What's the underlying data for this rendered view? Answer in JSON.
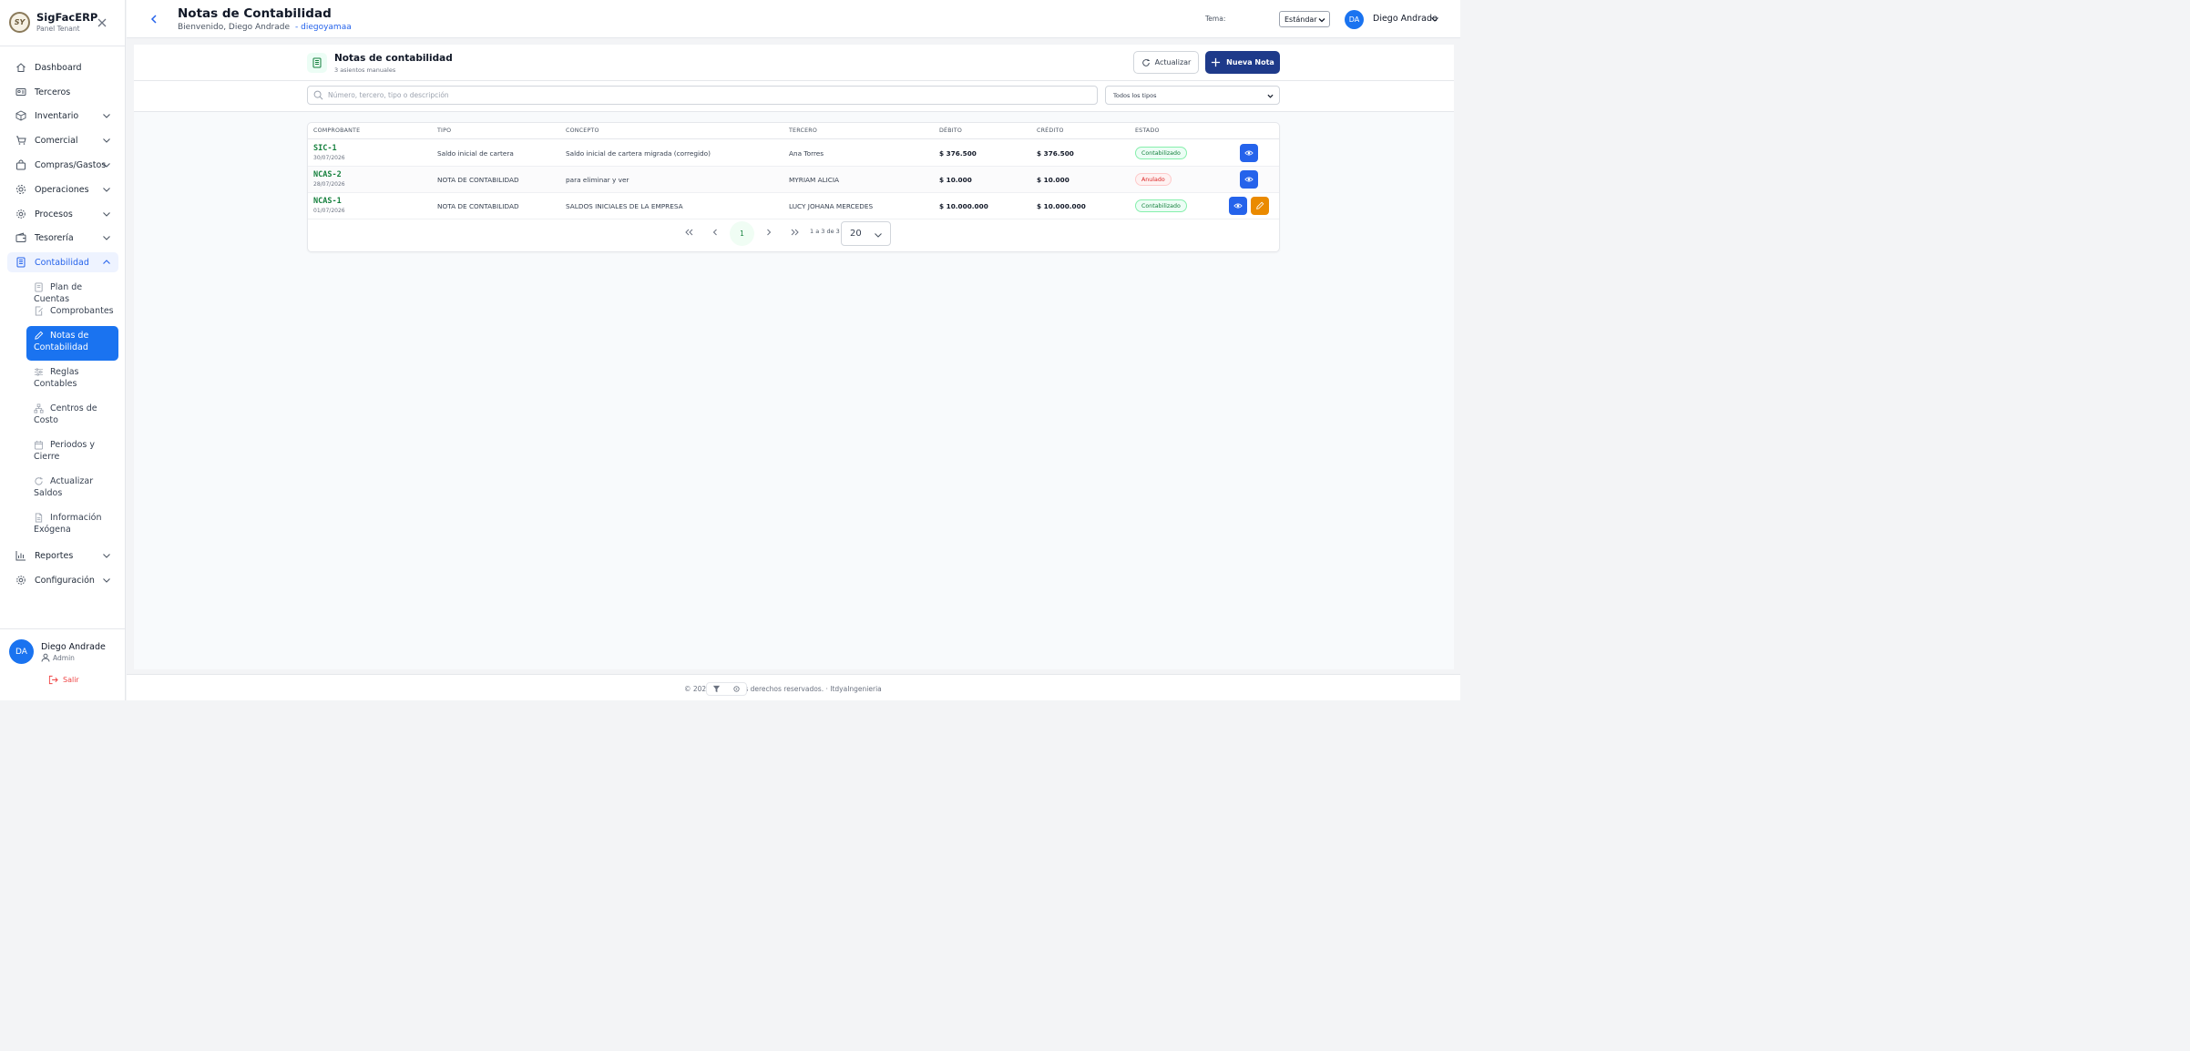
{
  "brand": {
    "logo_text": "SY",
    "name": "SigFacERP",
    "subtitle": "Panel Tenant"
  },
  "sidebar": {
    "items": [
      {
        "label": "Dashboard",
        "icon": "home-icon"
      },
      {
        "label": "Terceros",
        "icon": "id-card-icon"
      },
      {
        "label": "Inventario",
        "icon": "box-icon"
      },
      {
        "label": "Comercial",
        "icon": "cart-icon"
      },
      {
        "label": "Compras/Gastos",
        "icon": "bag-icon"
      },
      {
        "label": "Operaciones",
        "icon": "gear-icon"
      },
      {
        "label": "Procesos",
        "icon": "cog-icon"
      },
      {
        "label": "Tesorería",
        "icon": "wallet-icon"
      },
      {
        "label": "Contabilidad",
        "icon": "ledger-icon"
      },
      {
        "label": "Reportes",
        "icon": "bar-chart-icon"
      },
      {
        "label": "Configuración",
        "icon": "settings-icon"
      }
    ],
    "contabilidad_sub": [
      {
        "label": "Plan de Cuentas"
      },
      {
        "label": "Comprobantes"
      },
      {
        "label": "Notas de Contabilidad"
      },
      {
        "label": "Reglas Contables"
      },
      {
        "label": "Centros de Costo"
      },
      {
        "label": "Periodos y Cierre"
      },
      {
        "label": "Actualizar Saldos"
      },
      {
        "label": "Información Exógena"
      }
    ],
    "user": {
      "initials": "DA",
      "name": "Diego Andrade",
      "role": "Admin"
    },
    "logout_label": "Salir"
  },
  "header": {
    "title": "Notas de Contabilidad",
    "welcome": "Bienvenido, Diego Andrade",
    "tenant": "- diegoyamaa",
    "theme_label": "Tema:",
    "theme_value": "Estándar",
    "user_initials": "DA",
    "user_name": "Diego Andrade"
  },
  "toolbar": {
    "title": "Notas de contabilidad",
    "count": "3 asientos manuales",
    "refresh_label": "Actualizar",
    "new_label": "Nueva Nota"
  },
  "search": {
    "placeholder": "Número, tercero, tipo o descripción",
    "type_filter": "Todos los tipos"
  },
  "table": {
    "columns": [
      "COMPROBANTE",
      "TIPO",
      "CONCEPTO",
      "TERCERO",
      "DÉBITO",
      "CRÉDITO",
      "ESTADO"
    ],
    "rows": [
      {
        "code": "SIC-1",
        "date": "30/07/2026",
        "tipo": "Saldo inicial de cartera",
        "concepto": "Saldo inicial de cartera migrada (corregido)",
        "tercero": "Ana Torres",
        "debito": "$ 376.500",
        "credito": "$ 376.500",
        "estado": "Contabilizado"
      },
      {
        "code": "NCAS-2",
        "date": "28/07/2026",
        "tipo": "NOTA DE CONTABILIDAD",
        "concepto": "para eliminar y ver",
        "tercero": "MYRIAM ALICIA",
        "debito": "$ 10.000",
        "credito": "$ 10.000",
        "estado": "Anulado"
      },
      {
        "code": "NCAS-1",
        "date": "01/07/2026",
        "tipo": "NOTA DE CONTABILIDAD",
        "concepto": "SALDOS INICIALES DE LA EMPRESA",
        "tercero": "LUCY JOHANA MERCEDES",
        "debito": "$ 10.000.000",
        "credito": "$ 10.000.000",
        "estado": "Contabilizado"
      }
    ]
  },
  "pagination": {
    "current_page": "1",
    "info": "1 a 3 de 3",
    "page_size": "20"
  },
  "footer": {
    "text": "© 2026 · Todos los derechos reservados. · ItdyaIngenieria"
  },
  "colors": {
    "accent": "#1a73f0",
    "primary_button": "#1e3a8a",
    "success": "#15803d",
    "danger": "#dc2626",
    "edit": "#ea8a00"
  }
}
